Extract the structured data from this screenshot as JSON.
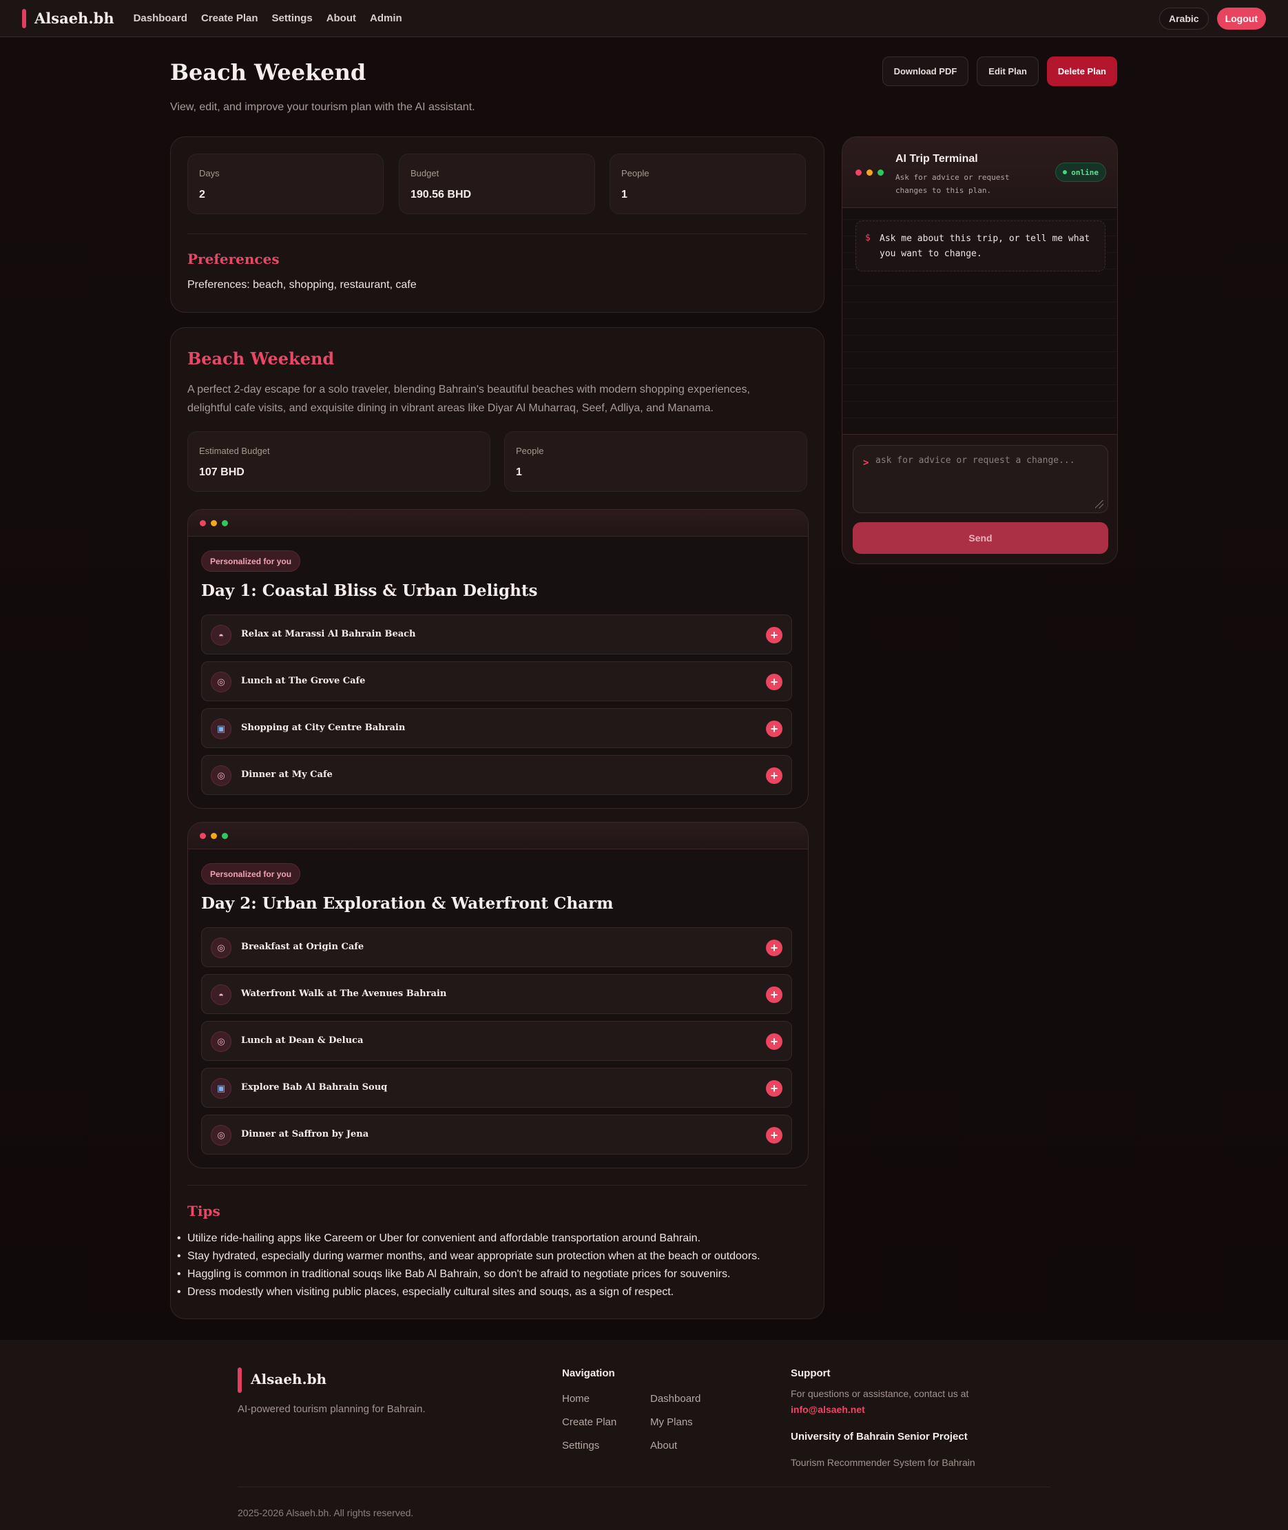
{
  "nav": {
    "brand": "Alsaeh.bh",
    "links": [
      "Dashboard",
      "Create Plan",
      "Settings",
      "About",
      "Admin"
    ],
    "language_button": "Arabic",
    "logout_button": "Logout"
  },
  "header": {
    "title": "Beach Weekend",
    "subtitle": "View, edit, and improve your tourism plan with the AI assistant.",
    "download_button": "Download PDF",
    "edit_button": "Edit Plan",
    "delete_button": "Delete Plan"
  },
  "summary": {
    "stats": [
      {
        "label": "Days",
        "value": "2"
      },
      {
        "label": "Budget",
        "value": "190.56 BHD"
      },
      {
        "label": "People",
        "value": "1"
      }
    ],
    "preferences_heading": "Preferences",
    "preferences_text": "Preferences: beach, shopping, restaurant, cafe"
  },
  "plan": {
    "title": "Beach Weekend",
    "description": "A perfect 2-day escape for a solo traveler, blending Bahrain's beautiful beaches with modern shopping experiences, delightful cafe visits, and exquisite dining in vibrant areas like Diyar Al Muharraq, Seef, Adliya, and Manama.",
    "stats": [
      {
        "label": "Estimated Budget",
        "value": "107 BHD"
      },
      {
        "label": "People",
        "value": "1"
      }
    ],
    "days": [
      {
        "badge": "Personalized for you",
        "title": "Day 1: Coastal Bliss & Urban Delights",
        "activities": [
          {
            "icon": "beach-icon",
            "label": "Relax at Marassi Al Bahrain Beach"
          },
          {
            "icon": "dining-icon",
            "label": "Lunch at The Grove Cafe"
          },
          {
            "icon": "shopping-icon",
            "label": "Shopping at City Centre Bahrain"
          },
          {
            "icon": "dining-icon",
            "label": "Dinner at My Cafe"
          }
        ]
      },
      {
        "badge": "Personalized for you",
        "title": "Day 2: Urban Exploration & Waterfront Charm",
        "activities": [
          {
            "icon": "dining-icon",
            "label": "Breakfast at Origin Cafe"
          },
          {
            "icon": "beach-icon",
            "label": "Waterfront Walk at The Avenues Bahrain"
          },
          {
            "icon": "dining-icon",
            "label": "Lunch at Dean & Deluca"
          },
          {
            "icon": "shopping-icon",
            "label": "Explore Bab Al Bahrain Souq"
          },
          {
            "icon": "dining-icon",
            "label": "Dinner at Saffron by Jena"
          }
        ]
      }
    ],
    "tips_heading": "Tips",
    "tips": [
      "Utilize ride-hailing apps like Careem or Uber for convenient and affordable transportation around Bahrain.",
      "Stay hydrated, especially during warmer months, and wear appropriate sun protection when at the beach or outdoors.",
      "Haggling is common in traditional souqs like Bab Al Bahrain, so don't be afraid to negotiate prices for souvenirs.",
      "Dress modestly when visiting public places, especially cultural sites and souqs, as a sign of respect."
    ]
  },
  "terminal": {
    "title": "AI Trip Terminal",
    "subtitle": "Ask for advice or request changes to this plan.",
    "status": "online",
    "prompt_symbol": "$",
    "message": "Ask me about this trip, or tell me what you want to change.",
    "caret_symbol": ">",
    "input_placeholder": "ask for advice or request a change...",
    "send_button": "Send"
  },
  "footer": {
    "brand": "Alsaeh.bh",
    "tagline": "AI-powered tourism planning for Bahrain.",
    "navigation_heading": "Navigation",
    "nav_links": [
      "Home",
      "Dashboard",
      "Create Plan",
      "My Plans",
      "Settings",
      "About"
    ],
    "support_heading": "Support",
    "support_text": "For questions or assistance, contact us at",
    "support_email": "info@alsaeh.net",
    "university_heading": "University of Bahrain Senior Project",
    "university_text": "Tourism Recommender System for Bahrain",
    "copyright": "2025-2026 Alsaeh.bh. All rights reserved."
  },
  "colors": {
    "accent": "#e8435f",
    "background": "#140c0c",
    "card": "#1b1312",
    "online_green": "#43d77a"
  }
}
